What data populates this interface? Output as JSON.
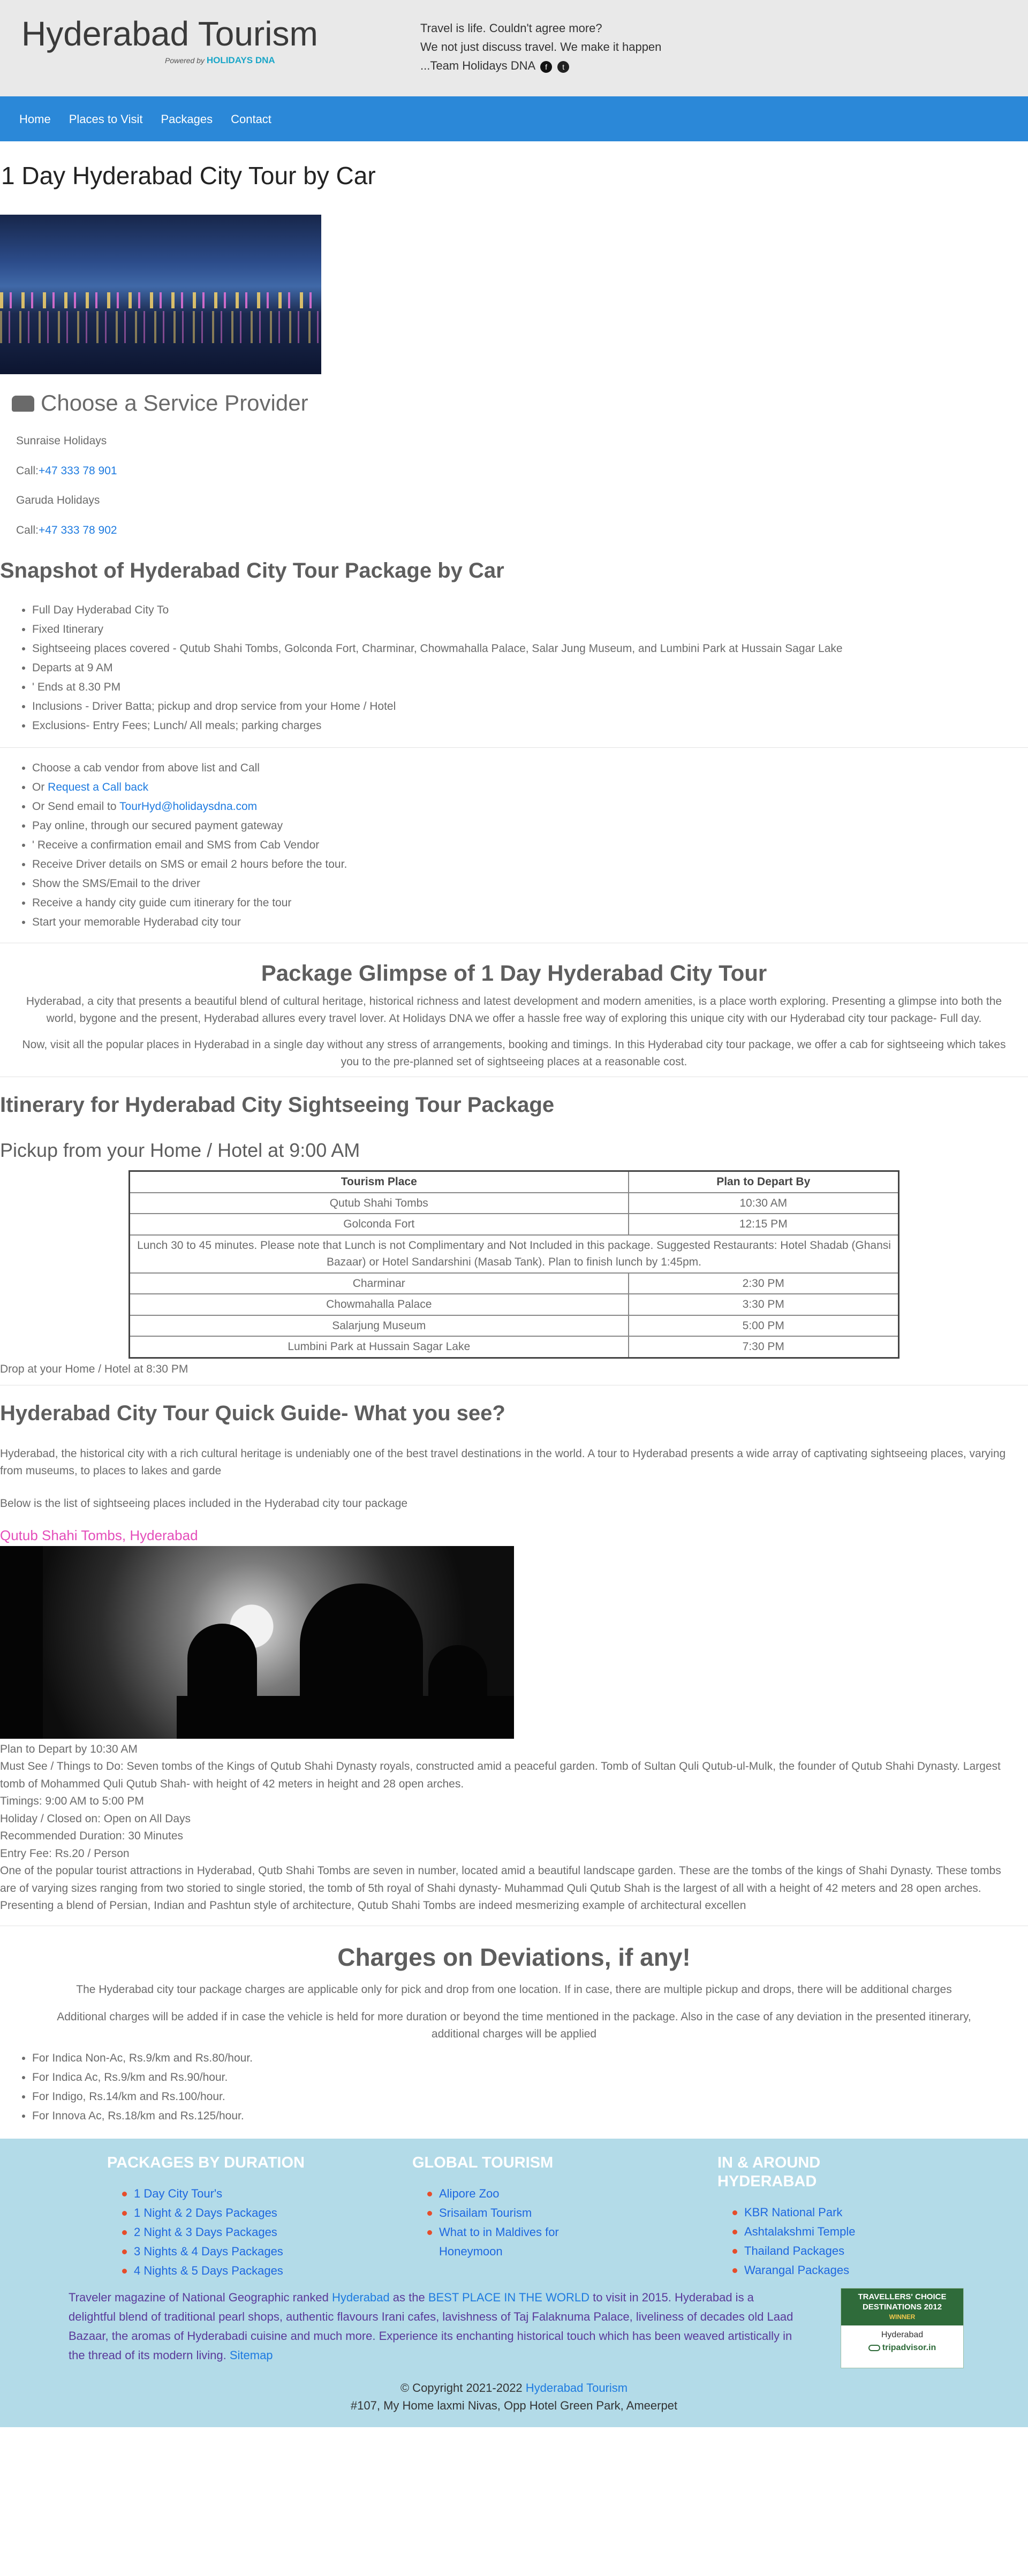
{
  "header": {
    "title": "Hyderabad Tourism",
    "powered_prefix": "Powered by",
    "powered_brand": "HOLIDAYS DNA",
    "tagline_1": "Travel is life. Couldn't agree more?",
    "tagline_2": "We not just discuss travel. We make it happen",
    "tagline_3": "...Team Holidays DNA",
    "facebook_glyph": "f",
    "twitter_glyph": "t"
  },
  "nav": {
    "items": [
      "Home",
      "Places to Visit",
      "Packages",
      "Contact"
    ]
  },
  "page_title": "1 Day Hyderabad City Tour by Car",
  "providers": {
    "title": "Choose a Service Provider",
    "list": [
      {
        "name": "Sunraise Holidays",
        "call_label": "Call:",
        "phone": "+47 333 78 901"
      },
      {
        "name": "Garuda Holidays",
        "call_label": "Call:",
        "phone": "+47 333 78 902"
      }
    ]
  },
  "snapshot": {
    "title": "Snapshot of Hyderabad City Tour Package by Car",
    "items": [
      "Full Day Hyderabad City To",
      "Fixed Itinerary",
      "Sightseeing places covered - Qutub Shahi Tombs, Golconda Fort, Charminar, Chowmahalla Palace, Salar Jung Museum, and Lumbini Park at Hussain Sagar Lake",
      "Departs at 9 AM",
      "' Ends at 8.30 PM",
      "Inclusions - Driver Batta; pickup and drop service from your Home / Hotel",
      "Exclusions- Entry Fees; Lunch/ All meals; parking charges"
    ]
  },
  "booking": {
    "item1": "Choose a cab vendor from above list and Call",
    "or1": "Or ",
    "callback_link": "Request a Call back",
    "or2": "Or Send email to ",
    "email": "TourHyd@holidaysdna.com",
    "rest": [
      "Pay online, through our secured payment gateway",
      "' Receive a confirmation email and SMS from Cab Vendor",
      "Receive Driver details on SMS or email 2 hours before the tour.",
      "Show the SMS/Email to the driver",
      "Receive a handy city guide cum itinerary for the tour",
      "Start your memorable Hyderabad city tour"
    ]
  },
  "glimpse": {
    "title": "Package Glimpse of 1 Day Hyderabad City Tour",
    "p1": "Hyderabad, a city that presents a beautiful blend of cultural heritage, historical richness and latest development and modern amenities, is a place worth exploring. Presenting a glimpse into both the world, bygone and the present, Hyderabad allures every travel lover. At Holidays DNA we offer a hassle free way of exploring this unique city with our Hyderabad city tour package- Full day.",
    "p2": "Now, visit all the popular places in Hyderabad in a single day without any stress of arrangements, booking and timings. In this Hyderabad city tour package, we offer a cab for sightseeing which takes you to the pre-planned set of sightseeing places at a reasonable cost."
  },
  "itinerary": {
    "title": "Itinerary for Hyderabad City Sightseeing Tour Package",
    "pickup": "Pickup from your Home / Hotel at 9:00 AM",
    "col_place": "Tourism Place",
    "col_time": "Plan to Depart By",
    "rows_a": [
      {
        "place": "Qutub Shahi Tombs",
        "time": "10:30 AM"
      },
      {
        "place": "Golconda Fort",
        "time": "12:15 PM"
      }
    ],
    "lunch": "Lunch 30 to 45 minutes. Please note that Lunch is not Complimentary and Not Included in this package. Suggested Restaurants: Hotel Shadab (Ghansi Bazaar) or Hotel Sandarshini (Masab Tank). Plan to finish lunch by 1:45pm.",
    "rows_b": [
      {
        "place": "Charminar",
        "time": "2:30 PM"
      },
      {
        "place": "Chowmahalla Palace",
        "time": "3:30 PM"
      },
      {
        "place": "Salarjung Museum",
        "time": "5:00 PM"
      },
      {
        "place": "Lumbini Park at Hussain Sagar Lake",
        "time": "7:30 PM"
      }
    ],
    "drop": "Drop at your Home / Hotel at 8:30 PM"
  },
  "guide": {
    "title": "Hyderabad City Tour Quick Guide- What you see?",
    "intro": "Hyderabad, the historical city with a rich cultural heritage is undeniably one of the best travel destinations in the world. A tour to Hyderabad presents a wide array of captivating sightseeing places, varying from museums, to places to lakes and garde",
    "list_intro": "Below is the list of sightseeing places included in the Hyderabad city tour package",
    "place_title": "Qutub Shahi Tombs, Hyderabad",
    "lines": [
      "Plan to Depart by 10:30 AM",
      "Must See / Things to Do: Seven tombs of the Kings of Qutub Shahi Dynasty royals, constructed amid a peaceful garden. Tomb of Sultan Quli Qutub-ul-Mulk, the founder of Qutub Shahi Dynasty. Largest tomb of Mohammed Quli Qutub Shah- with height of 42 meters in height and 28 open arches.",
      "Timings: 9:00 AM to 5:00 PM",
      "Holiday / Closed on: Open on All Days",
      "Recommended Duration: 30 Minutes",
      "Entry Fee: Rs.20 / Person",
      "One of the popular tourist attractions in Hyderabad, Qutb Shahi Tombs are seven in number, located amid a beautiful landscape garden. These are the tombs of the kings of Shahi Dynasty. These tombs are of varying sizes ranging from two storied to single storied, the tomb of 5th royal of Shahi dynasty- Muhammad Quli Qutub Shah is the largest of all with a height of 42 meters and 28 open arches. Presenting a blend of Persian, Indian and Pashtun style of architecture, Qutub Shahi Tombs are indeed mesmerizing example of architectural excellen"
    ]
  },
  "charges": {
    "title": "Charges on Deviations, if any!",
    "p1": "The Hyderabad city tour package charges are applicable only for pick and drop from one location. If in case, there are multiple pickup and drops, there will be additional charges",
    "p2": "Additional charges will be added if in case the vehicle is held for more duration or beyond the time mentioned in the package. Also in the case of any deviation in the presented itinerary, additional charges will be applied",
    "items": [
      "For Indica Non-Ac, Rs.9/km and Rs.80/hour.",
      "For Indica Ac, Rs.9/km and Rs.90/hour.",
      "For Indigo, Rs.14/km and Rs.100/hour.",
      "For Innova Ac, Rs.18/km and Rs.125/hour."
    ]
  },
  "footer": {
    "col1_title": "PACKAGES BY DURATION",
    "col1_items": [
      "1 Day City Tour's",
      "1 Night & 2 Days Packages",
      "2 Night & 3 Days Packages",
      "3 Nights & 4 Days Packages",
      "4 Nights & 5 Days Packages"
    ],
    "col2_title": "GLOBAL TOURISM",
    "col2_items": [
      "Alipore Zoo",
      "Srisailam Tourism",
      "What to in Maldives for Honeymoon"
    ],
    "col3_title_1": "IN & AROUND",
    "col3_title_2": "HYDERABAD",
    "col3_items": [
      "KBR National Park",
      "Ashtalakshmi Temple",
      "Thailand Packages",
      "Warangal Packages"
    ],
    "about_1": "Traveler magazine of National Geographic ranked ",
    "about_link1": "Hyderabad",
    "about_2": " as the ",
    "about_link2": "BEST PLACE IN THE WORLD",
    "about_3": " to visit in 2015. Hyderabad is a delightful blend of traditional pearl shops, authentic flavours Irani cafes, lavishness of Taj Falaknuma Palace, liveliness of decades old Laad Bazaar, the aromas of Hyderabadi cuisine and much more. Experience its enchanting historical touch which has been weaved artistically in the thread of its modern living. ",
    "sitemap": "Sitemap",
    "badge_line1": "TRAVELLERS' CHOICE",
    "badge_line2": "DESTINATIONS 2012",
    "badge_winner": "WINNER",
    "badge_city": "Hyderabad",
    "badge_brand": "tripadvisor.in",
    "copyright": "© Copyright 2021-2022 ",
    "copyright_link": "Hyderabad Tourism",
    "address": "#107, My Home laxmi Nivas, Opp Hotel Green Park, Ameerpet"
  },
  "colors": {
    "nav": "#2b88d8",
    "footer": "#b3dbe8",
    "link": "#1e7be0",
    "accent_pink": "#e44dba"
  }
}
